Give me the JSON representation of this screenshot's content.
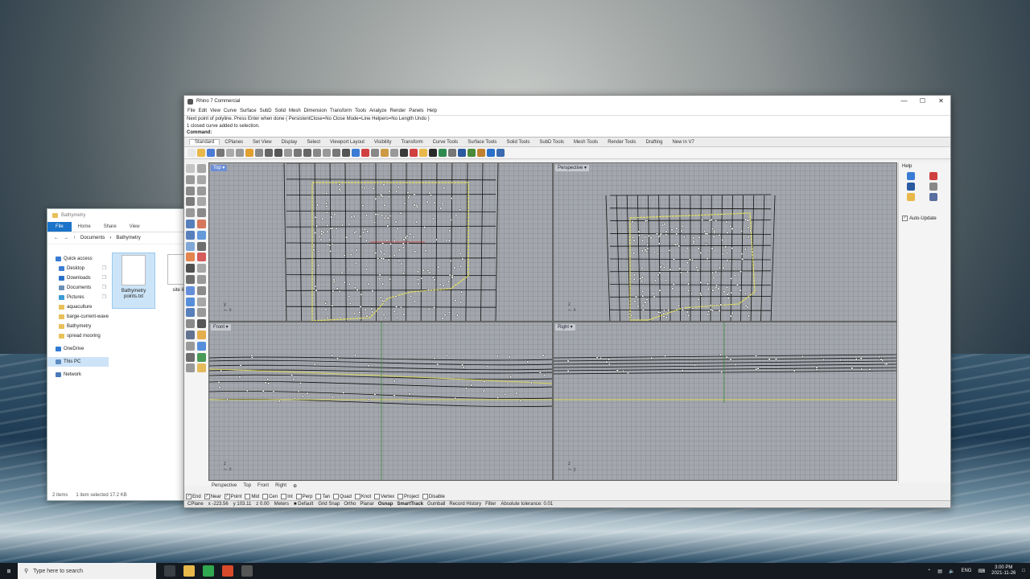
{
  "explorer": {
    "title": "Bathymetry",
    "ribbon": [
      "File",
      "Home",
      "Share",
      "View"
    ],
    "address": [
      "Documents",
      "Bathymetry"
    ],
    "nav": [
      {
        "label": "Quick access",
        "color": "#3a7bd5",
        "sub": false
      },
      {
        "label": "Desktop",
        "color": "#3a7bd5",
        "sub": true,
        "pin": "❒"
      },
      {
        "label": "Downloads",
        "color": "#2a6fc9",
        "sub": true,
        "pin": "❒"
      },
      {
        "label": "Documents",
        "color": "#6c8fb5",
        "sub": true,
        "pin": "❒"
      },
      {
        "label": "Pictures",
        "color": "#3a9bd5",
        "sub": true,
        "pin": "❒"
      },
      {
        "label": "aquaculture",
        "color": "#e8c05a",
        "sub": true
      },
      {
        "label": "barge-current-wave",
        "color": "#e8c05a",
        "sub": true
      },
      {
        "label": "Bathymetry",
        "color": "#e8c05a",
        "sub": true
      },
      {
        "label": "spread mooring",
        "color": "#e8c05a",
        "sub": true
      },
      {
        "label": "OneDrive",
        "color": "#2f7bd3",
        "sub": false,
        "gap": true
      },
      {
        "label": "This PC",
        "color": "#5c8bc0",
        "sub": false,
        "gap": true,
        "selected": true
      },
      {
        "label": "Network",
        "color": "#4a79b8",
        "sub": false,
        "gap": true
      }
    ],
    "files": [
      {
        "name": "Bathymetry points.txt",
        "selected": true
      },
      {
        "name": "site lin",
        "selected": false
      }
    ],
    "status_items": "2 items",
    "status_selected": "1 item selected  17.2 KB"
  },
  "rhino": {
    "title": "Rhino 7 Commercial",
    "window_controls": [
      "—",
      "☐",
      "✕"
    ],
    "menu": [
      "File",
      "Edit",
      "View",
      "Curve",
      "Surface",
      "SubD",
      "Solid",
      "Mesh",
      "Dimension",
      "Transform",
      "Tools",
      "Analyze",
      "Render",
      "Panels",
      "Help"
    ],
    "history_line1": "Next point of polyline. Press Enter when done ( PersistentClose=No  Close  Mode=Line  Helpers=No  Length  Undo )",
    "history_line2": "1 closed curve added to selection.",
    "command_prompt": "Command:",
    "toolbar_tabs": [
      "Standard",
      "CPlanes",
      "Set View",
      "Display",
      "Select",
      "Viewport Layout",
      "Visibility",
      "Transform",
      "Curve Tools",
      "Surface Tools",
      "Solid Tools",
      "SubD Tools",
      "Mesh Tools",
      "Render Tools",
      "Drafting",
      "New in V7"
    ],
    "viewports": {
      "top": "Top",
      "perspective": "Perspective",
      "front": "Front",
      "right": "Right"
    },
    "viewport_tabs": [
      "Perspective",
      "Top",
      "Front",
      "Right",
      "⊕"
    ],
    "osnaps": [
      {
        "label": "End",
        "checked": true
      },
      {
        "label": "Near",
        "checked": true
      },
      {
        "label": "Point",
        "checked": true
      },
      {
        "label": "Mid",
        "checked": false
      },
      {
        "label": "Cen",
        "checked": false
      },
      {
        "label": "Int",
        "checked": false
      },
      {
        "label": "Perp",
        "checked": false
      },
      {
        "label": "Tan",
        "checked": false
      },
      {
        "label": "Quad",
        "checked": false
      },
      {
        "label": "Knot",
        "checked": false
      },
      {
        "label": "Vertex",
        "checked": false
      },
      {
        "label": "Project",
        "checked": false
      },
      {
        "label": "Disable",
        "checked": false
      }
    ],
    "status": {
      "cplane": "CPlane",
      "x": "x -223.56",
      "y": "y 103.11",
      "z": "z 0.00",
      "units": "Meters",
      "layer": "Default",
      "modes": [
        "Grid Snap",
        "Ortho",
        "Planar",
        "Osnap",
        "SmartTrack",
        "Gumball",
        "Record History",
        "Filter"
      ],
      "bold_modes": [
        "Osnap",
        "SmartTrack"
      ],
      "tolerance": "Absolute tolerance: 0.01"
    },
    "panel": {
      "title": "Help",
      "auto_update": "Auto-Update"
    }
  },
  "taskbar": {
    "search_placeholder": "Type here to search",
    "lang": "ENG",
    "time": "3:00 PM",
    "date": "2021-11-26"
  }
}
